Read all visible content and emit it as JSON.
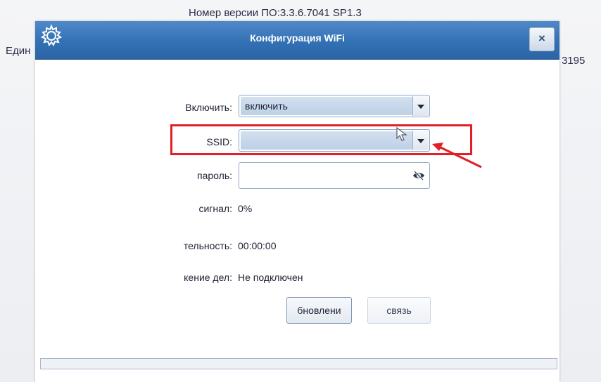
{
  "background": {
    "version_text": "Номер версии ПО:3.3.6.7041 SP1.3",
    "left_text": "Един",
    "right_text": "3195"
  },
  "dialog": {
    "title": "Конфигурация WiFi",
    "close_label": "×"
  },
  "form": {
    "enable": {
      "label": "Включить:",
      "value": "включить"
    },
    "ssid": {
      "label": "SSID:",
      "value": ""
    },
    "password": {
      "label": "пароль:",
      "value": ""
    },
    "signal": {
      "label": "сигнал:",
      "value": "0%"
    },
    "duration": {
      "label": "тельность:",
      "value": "00:00:00"
    },
    "status": {
      "label": "кение дел:",
      "value": "Не подключен"
    }
  },
  "buttons": {
    "refresh_label": "бновлени",
    "connect_label": "связь"
  },
  "colors": {
    "titlebar": "#3371b5",
    "highlight": "#e01f26",
    "combo_field": "#c7d7ea"
  },
  "icons": {
    "title": "gear-icon",
    "close": "close-icon",
    "dropdown": "chevron-down-icon",
    "password_toggle": "eye-slash-icon",
    "cursor": "mouse-cursor-icon",
    "annotation": "red-arrow-icon"
  }
}
